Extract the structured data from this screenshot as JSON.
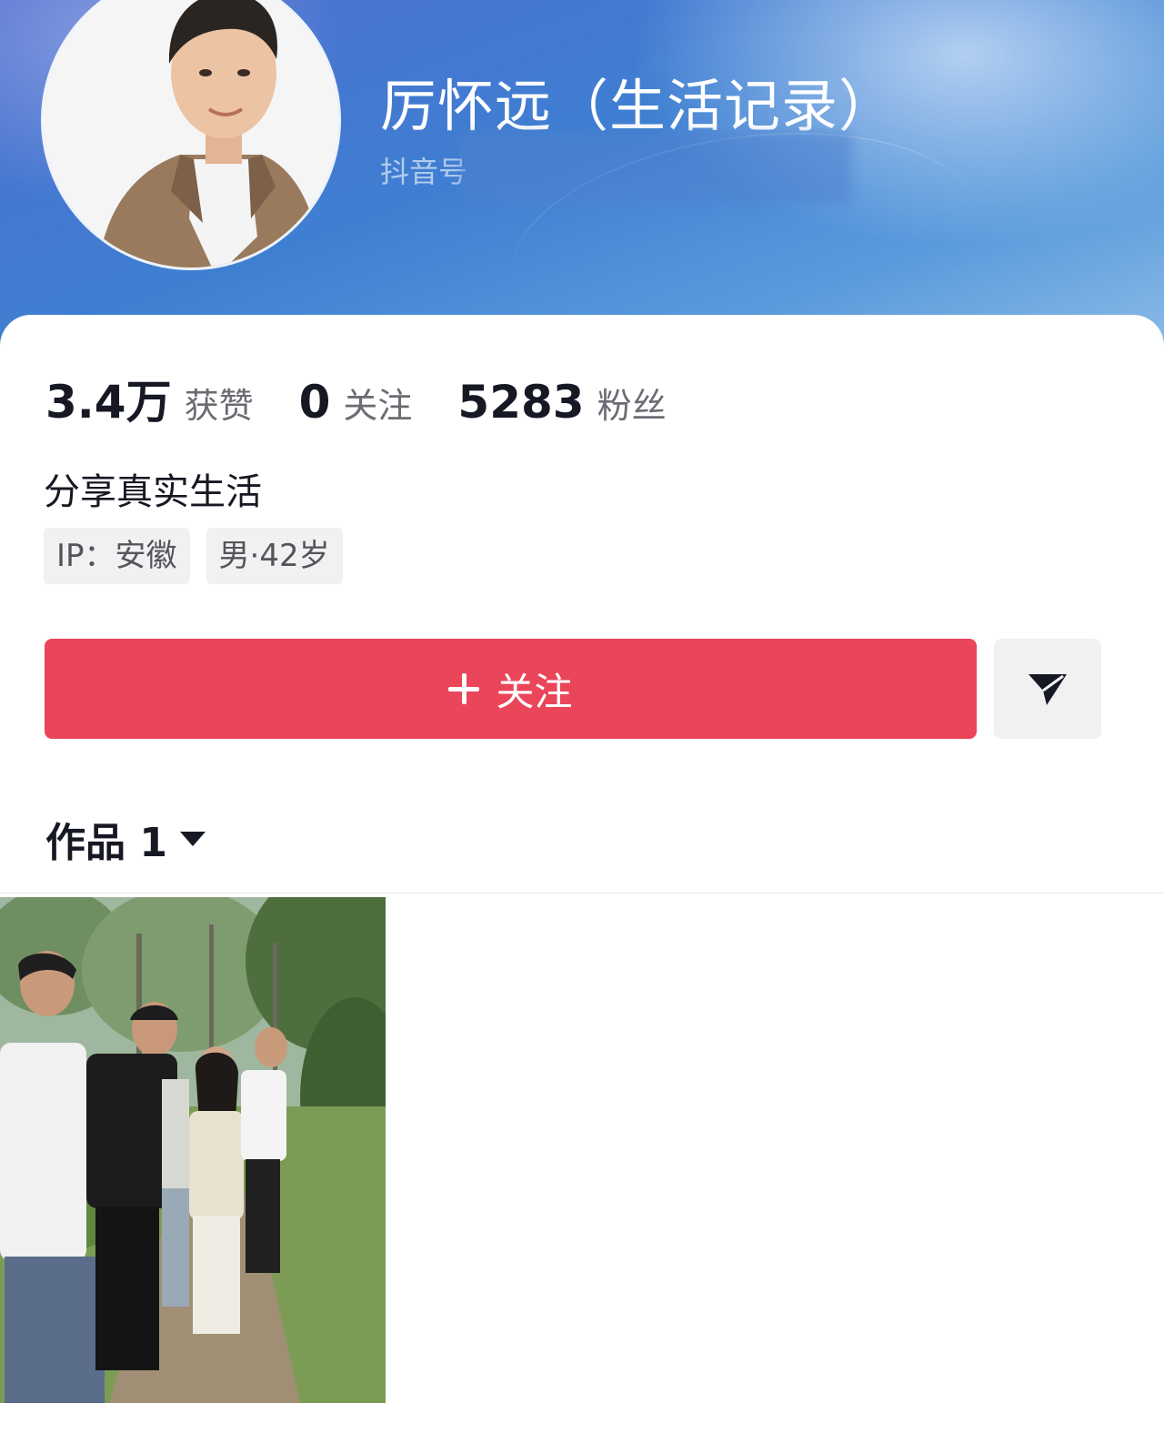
{
  "profile": {
    "nickname": "厉怀远（生活记录）",
    "douyin_id_label": "抖音号"
  },
  "stats": [
    {
      "value": "3.4万",
      "label": "获赞"
    },
    {
      "value": "0",
      "label": "关注"
    },
    {
      "value": "5283",
      "label": "粉丝"
    }
  ],
  "bio": "分享真实生活",
  "tags": [
    {
      "label": "IP：安徽"
    },
    {
      "label": "男·42岁"
    }
  ],
  "actions": {
    "follow_label": "关注",
    "share_icon": "send-icon"
  },
  "works": {
    "tab_label": "作品 1"
  },
  "colors": {
    "follow_button": "#ea4559",
    "header_blue": "#3e7fd2",
    "text_primary": "#161823",
    "text_secondary": "#6b6c73",
    "tag_background": "#f1f1f2"
  }
}
